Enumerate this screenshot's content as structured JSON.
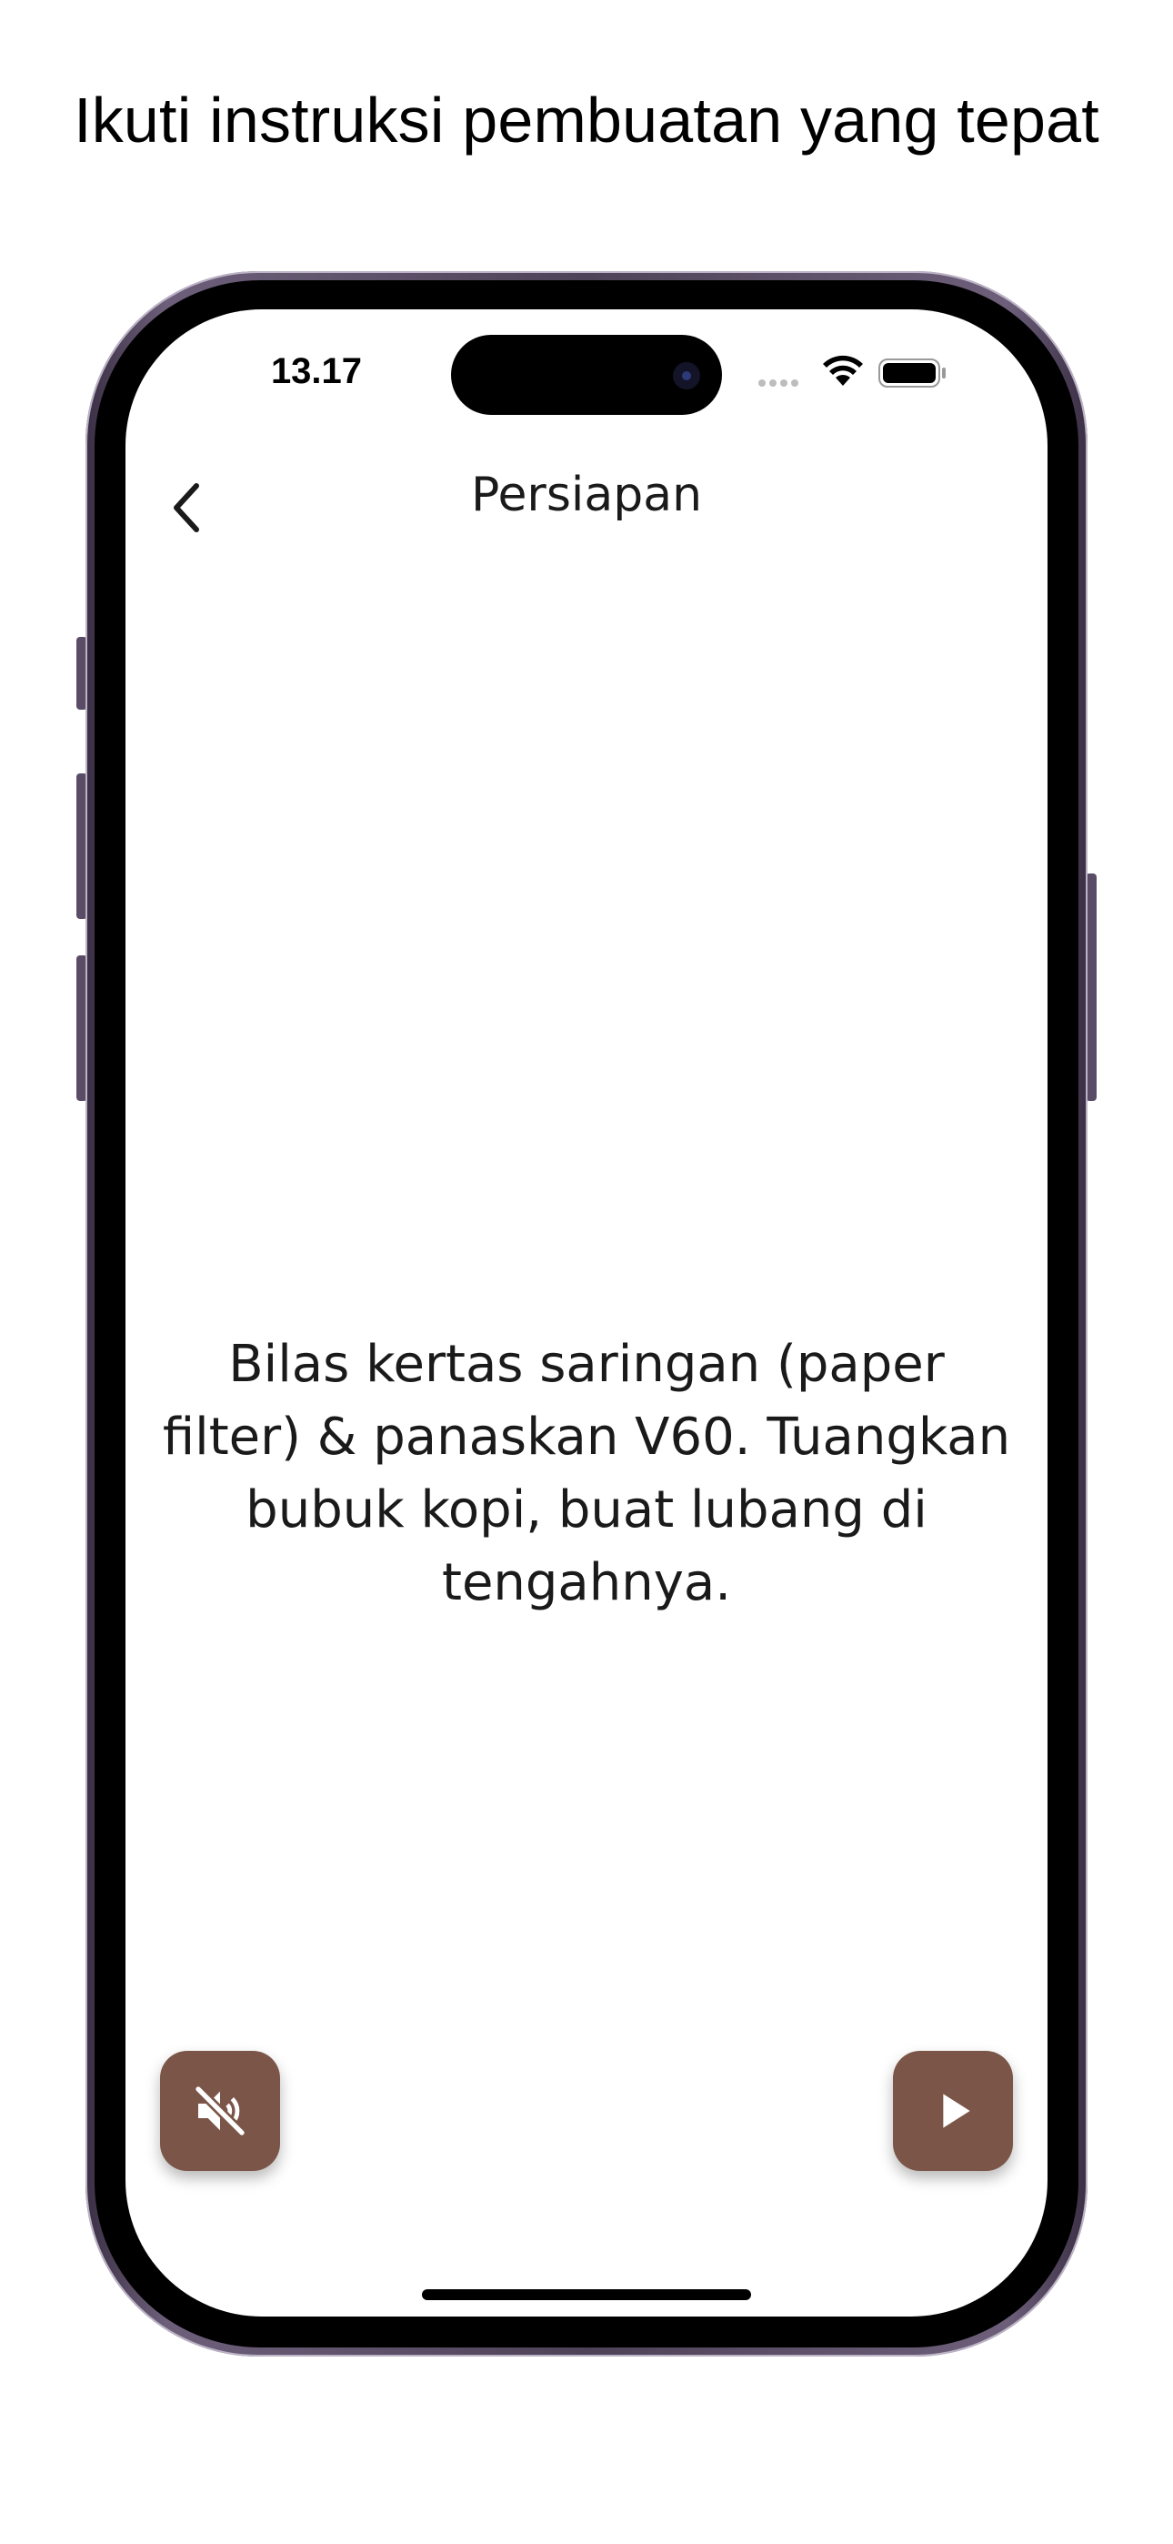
{
  "promo": {
    "headline": "Ikuti instruksi pembuatan yang tepat"
  },
  "status_bar": {
    "time": "13.17",
    "icons": [
      "signal-dots-icon",
      "wifi-icon",
      "battery-icon"
    ]
  },
  "nav": {
    "title": "Persiapan",
    "back_icon": "chevron-left-icon"
  },
  "step": {
    "instruction": "Bilas kertas saringan (paper filter) & panaskan V60. Tuangkan bubuk kopi, buat lubang di tengahnya."
  },
  "controls": {
    "mute_icon": "volume-off-icon",
    "play_icon": "play-icon",
    "button_color": "#7a5548"
  }
}
